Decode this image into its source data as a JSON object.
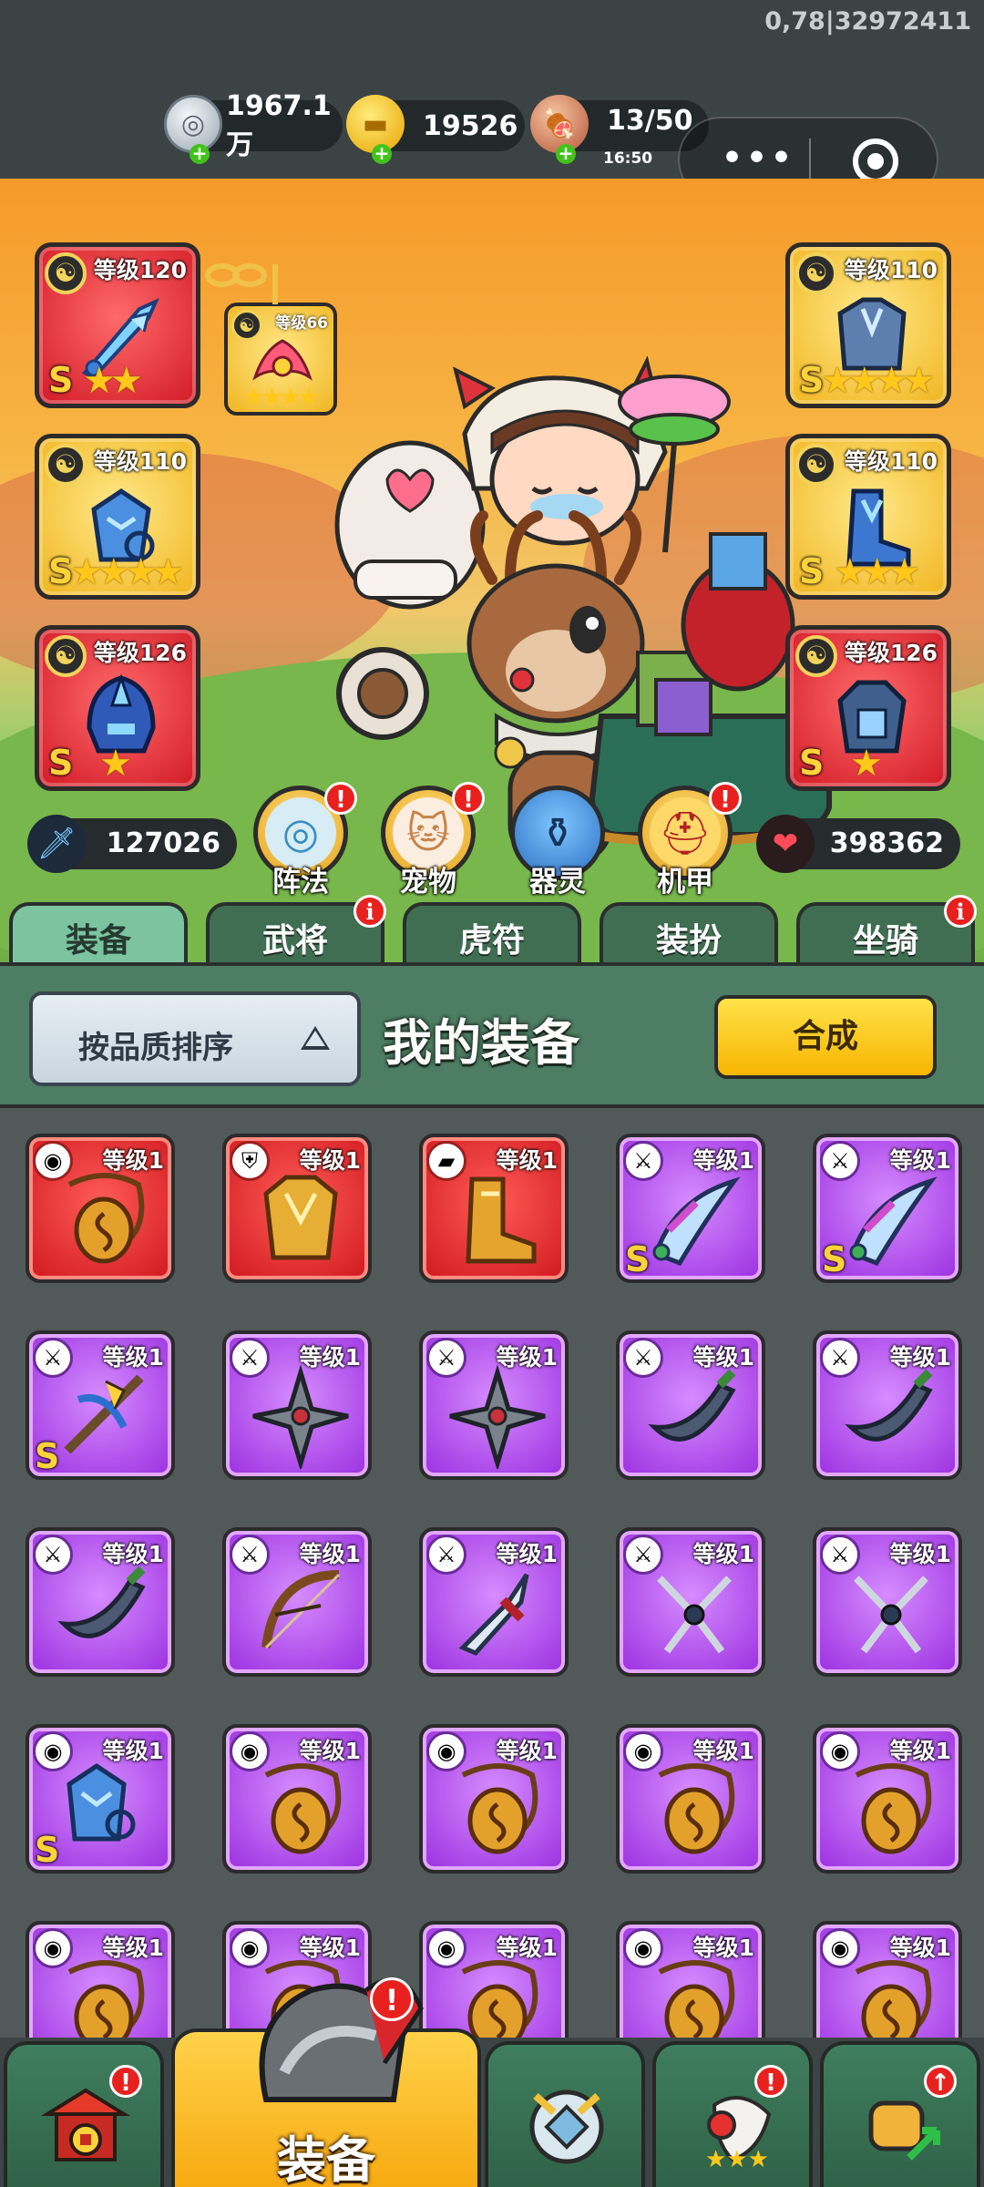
{
  "debug": {
    "coords": "0,78|32972411"
  },
  "resources": {
    "silver": "1967.1万",
    "gold": "19526",
    "stamina": "13/50",
    "stamina_timer": "16:50"
  },
  "equipped": {
    "weapon": {
      "level": "等级120",
      "rank": "S",
      "stars": 2,
      "quality": "red"
    },
    "pet": {
      "level": "等级66",
      "stars": 4,
      "quality": "gold"
    },
    "armor_left": {
      "level": "等级110",
      "rank": "S",
      "stars": 4,
      "quality": "gold"
    },
    "helmet_left": {
      "level": "等级126",
      "rank": "S",
      "stars": 1,
      "quality": "red"
    },
    "armor_right": {
      "level": "等级110",
      "rank": "S",
      "stars": 4,
      "quality": "gold"
    },
    "boots_right": {
      "level": "等级110",
      "rank": "S",
      "stars": 3,
      "quality": "gold"
    },
    "chest_right": {
      "level": "等级126",
      "rank": "S",
      "stars": 1,
      "quality": "red"
    }
  },
  "stats": {
    "attack": "127026",
    "hp": "398362"
  },
  "features": [
    {
      "label": "阵法",
      "alert": true
    },
    {
      "label": "宠物",
      "alert": true
    },
    {
      "label": "器灵",
      "alert": false
    },
    {
      "label": "机甲",
      "alert": true
    }
  ],
  "tabs": [
    {
      "label": "装备",
      "active": true,
      "info": false
    },
    {
      "label": "武将",
      "active": false,
      "info": true
    },
    {
      "label": "虎符",
      "active": false,
      "info": false
    },
    {
      "label": "装扮",
      "active": false,
      "info": false
    },
    {
      "label": "坐骑",
      "active": false,
      "info": true
    }
  ],
  "panel": {
    "sort_label": "按品质排序",
    "title": "我的装备",
    "compose_label": "合成"
  },
  "items": [
    {
      "level": "等级1",
      "quality": "red",
      "type": "necklace",
      "rank": ""
    },
    {
      "level": "等级1",
      "quality": "red",
      "type": "armor",
      "rank": ""
    },
    {
      "level": "等级1",
      "quality": "red",
      "type": "boots",
      "rank": ""
    },
    {
      "level": "等级1",
      "quality": "purple",
      "type": "scimitar",
      "rank": "S"
    },
    {
      "level": "等级1",
      "quality": "purple",
      "type": "scimitar",
      "rank": "S"
    },
    {
      "level": "等级1",
      "quality": "purple",
      "type": "crossbow",
      "rank": "S"
    },
    {
      "level": "等级1",
      "quality": "purple",
      "type": "shuriken",
      "rank": ""
    },
    {
      "level": "等级1",
      "quality": "purple",
      "type": "shuriken",
      "rank": ""
    },
    {
      "level": "等级1",
      "quality": "purple",
      "type": "blade",
      "rank": ""
    },
    {
      "level": "等级1",
      "quality": "purple",
      "type": "blade",
      "rank": ""
    },
    {
      "level": "等级1",
      "quality": "purple",
      "type": "blade",
      "rank": ""
    },
    {
      "level": "等级1",
      "quality": "purple",
      "type": "bow",
      "rank": ""
    },
    {
      "level": "等级1",
      "quality": "purple",
      "type": "dagger",
      "rank": ""
    },
    {
      "level": "等级1",
      "quality": "purple",
      "type": "trident",
      "rank": ""
    },
    {
      "level": "等级1",
      "quality": "purple",
      "type": "trident",
      "rank": ""
    },
    {
      "level": "等级1",
      "quality": "purple",
      "type": "ice-armor",
      "rank": "S"
    },
    {
      "level": "等级1",
      "quality": "purple",
      "type": "necklace",
      "rank": ""
    },
    {
      "level": "等级1",
      "quality": "purple",
      "type": "necklace",
      "rank": ""
    },
    {
      "level": "等级1",
      "quality": "purple",
      "type": "necklace",
      "rank": ""
    },
    {
      "level": "等级1",
      "quality": "purple",
      "type": "necklace",
      "rank": ""
    },
    {
      "level": "等级1",
      "quality": "purple",
      "type": "necklace",
      "rank": ""
    },
    {
      "level": "等级1",
      "quality": "purple",
      "type": "necklace",
      "rank": ""
    },
    {
      "level": "等级1",
      "quality": "purple",
      "type": "necklace",
      "rank": ""
    },
    {
      "level": "等级1",
      "quality": "purple",
      "type": "necklace",
      "rank": ""
    },
    {
      "level": "等级1",
      "quality": "purple",
      "type": "necklace",
      "rank": ""
    }
  ],
  "bottom_nav": [
    {
      "name": "shop",
      "alert": true
    },
    {
      "name": "equipment",
      "label": "装备",
      "alert": true,
      "active": true
    },
    {
      "name": "formation",
      "alert": false
    },
    {
      "name": "heroes",
      "alert": true
    },
    {
      "name": "upgrade",
      "alert": true
    }
  ],
  "colors": {
    "red_quality": "#d0181f",
    "purple_quality": "#9b2fe0",
    "gold_quality": "#f1b51f",
    "tab_active": "#7cc4a0",
    "panel_green": "#4d7d62"
  }
}
